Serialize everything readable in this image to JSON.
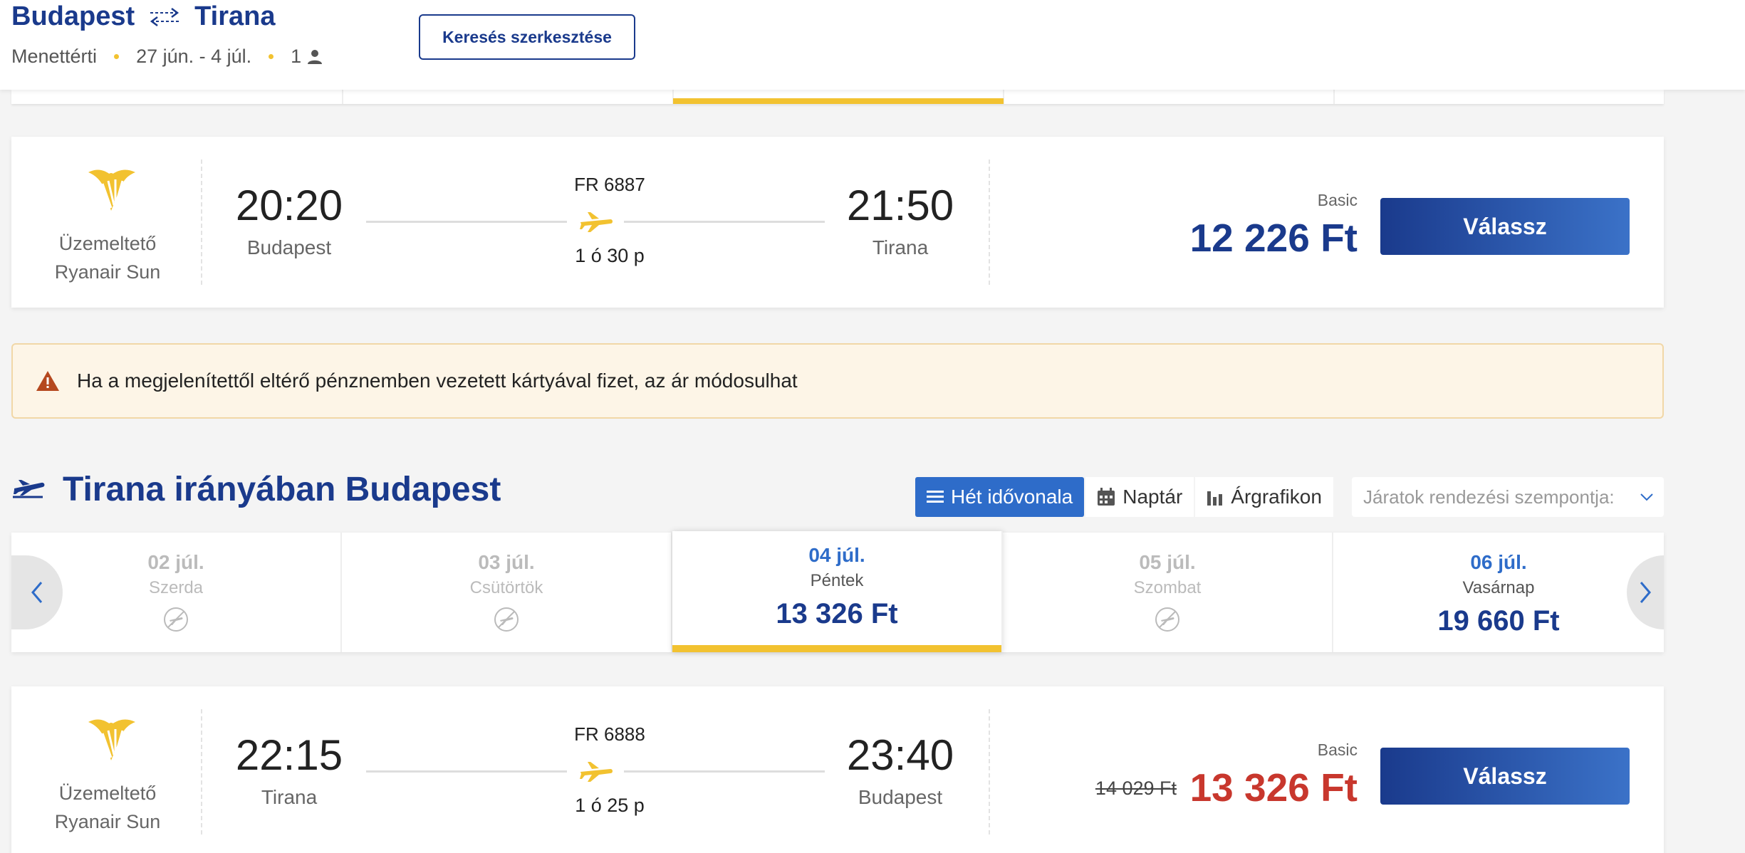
{
  "header": {
    "origin": "Budapest",
    "destination": "Tirana",
    "trip_type": "Menettérti",
    "dates": "27 jún. - 4 júl.",
    "passengers": "1",
    "edit_button": "Keresés szerkesztése",
    "icons": [
      "swap-arrows-icon",
      "person-icon"
    ]
  },
  "outbound_flight": {
    "operator_label": "Üzemeltető",
    "operator_name": "Ryanair Sun",
    "departure_time": "20:20",
    "departure_city": "Budapest",
    "flight_number": "FR 6887",
    "duration": "1 ó 30 p",
    "arrival_time": "21:50",
    "arrival_city": "Tirana",
    "fare_label": "Basic",
    "price": "12 226 Ft",
    "select_button": "Válassz"
  },
  "warning": {
    "text": "Ha a megjelenítettől eltérő pénznemben vezetett kártyával fizet, az ár módosulhat"
  },
  "return_section": {
    "title": "Tirana irányában Budapest",
    "tabs": [
      {
        "label": "Hét idővonala",
        "icon": "list-icon",
        "active": true
      },
      {
        "label": "Naptár",
        "icon": "calendar-icon",
        "active": false
      },
      {
        "label": "Árgrafikon",
        "icon": "bar-chart-icon",
        "active": false
      }
    ],
    "sort_placeholder": "Járatok rendezési szempontja:",
    "dates": [
      {
        "date": "02 júl.",
        "day": "Szerda",
        "price": null
      },
      {
        "date": "03 júl.",
        "day": "Csütörtök",
        "price": null
      },
      {
        "date": "04 júl.",
        "day": "Péntek",
        "price": "13 326 Ft",
        "active": true
      },
      {
        "date": "05 júl.",
        "day": "Szombat",
        "price": null
      },
      {
        "date": "06 júl.",
        "day": "Vasárnap",
        "price": "19 660 Ft"
      }
    ]
  },
  "return_flight": {
    "operator_label": "Üzemeltető",
    "operator_name": "Ryanair Sun",
    "departure_time": "22:15",
    "departure_city": "Tirana",
    "flight_number": "FR 6888",
    "duration": "1 ó 25 p",
    "arrival_time": "23:40",
    "arrival_city": "Budapest",
    "fare_label": "Basic",
    "old_price": "14 029 Ft",
    "price": "13 326 Ft",
    "select_button": "Válassz"
  },
  "colors": {
    "brand_blue": "#1a3a8c",
    "accent_blue": "#2e6cc9",
    "accent_yellow": "#f2c230",
    "sale_red": "#c8372d",
    "warning_bg": "#fdf5e7"
  }
}
